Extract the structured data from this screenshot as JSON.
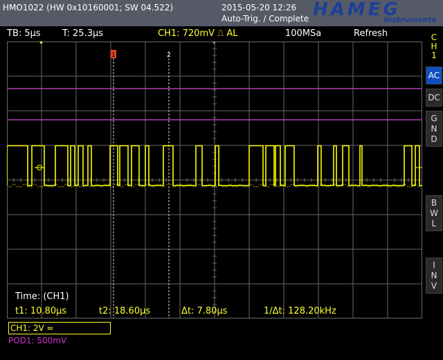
{
  "header": {
    "device": "HMO1022 (HW 0x10160001; SW 04.522)",
    "date": "2015-05-20 12:26",
    "status": "Auto-Trig. / Complete",
    "logo_main": "HAMEG",
    "logo_sub": "Instruments"
  },
  "infobar": {
    "timebase": "TB: 5µs",
    "trigger_time": "T: 25.3µs",
    "ch1_trigger": "CH1: 720mV ⎍ AL",
    "sample_rate": "100MSa",
    "mode": "Refresh"
  },
  "side": {
    "channel": "C\nH\n1",
    "buttons": [
      "AC",
      "DC",
      "G\nN\nD",
      "B\nW\nL",
      "I\nN\nV"
    ],
    "selected": "AC"
  },
  "markers": {
    "cursor1": "1",
    "cursor2": "2",
    "ref0": "0",
    "ref1": "1",
    "ch_marker": "1"
  },
  "measurement": {
    "title": "Time: (CH1)",
    "t1": "t1: 10.80µs",
    "t2": "t2: 18.60µs",
    "dt": "Δt: 7.80µs",
    "inv_dt": "1/Δt: 128.20kHz"
  },
  "bottom": {
    "ch1": "CH1: 2V ≈",
    "pod1": "POD1: 500mV"
  },
  "colors": {
    "trace": "#ffff00",
    "reference": "#b040b0",
    "grid": "#6a6a6a",
    "selected": "#0f4fc0"
  },
  "signal": {
    "time_per_div_us": 5,
    "divisions": 12,
    "low_level_div": 0,
    "high_level_div": 1.15,
    "transitions_us": [
      0.0,
      3.0,
      3.6,
      5.4,
      7.0,
      8.8,
      9.2,
      9.8,
      10.3,
      11.0,
      11.7,
      12.2,
      14.9,
      16.0,
      16.3,
      17.5,
      18.0,
      19.1,
      20.0,
      20.5,
      22.6,
      24.0,
      27.3,
      28.2,
      30.1,
      30.6,
      35.0,
      37.0,
      37.4,
      38.6,
      38.8,
      39.5,
      40.2,
      41.5,
      44.9,
      45.4,
      47.2,
      47.6,
      48.5,
      49.4,
      51.0,
      51.3,
      57.4,
      58.5,
      59.0,
      59.6
    ]
  }
}
